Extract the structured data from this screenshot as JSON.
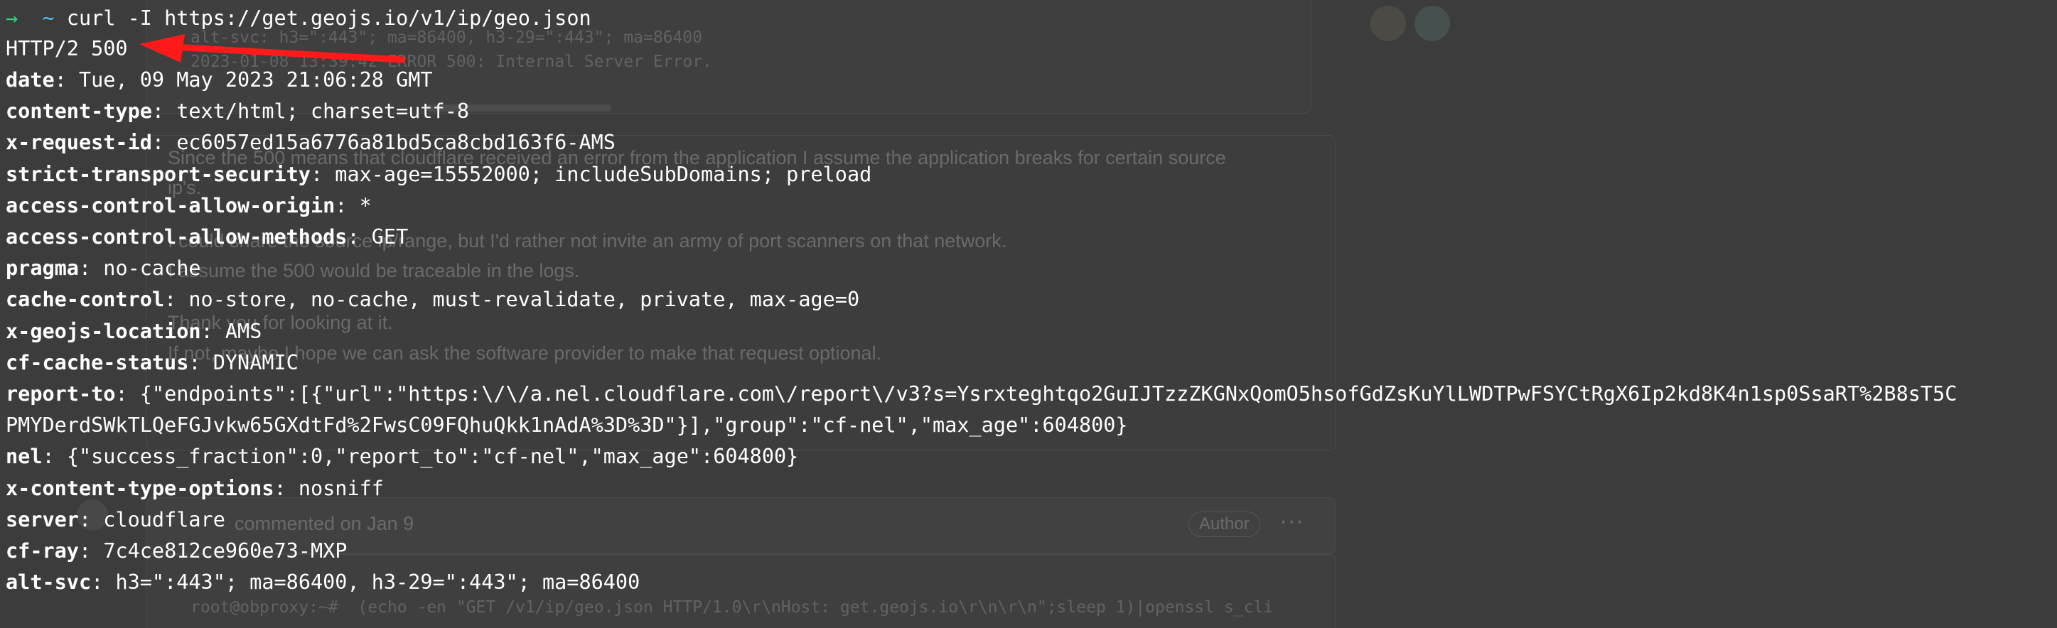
{
  "background": {
    "code_top_1": "alt-svc: h3=\":443\"; ma=86400, h3-29=\":443\"; ma=86400",
    "code_top_2": "2023-01-08 13:39:42 ERROR 500: Internal Server Error.",
    "para_1": "Since the 500 means that cloudflare received an error from the application I assume the application breaks for certain source",
    "para_1b": "ip's.",
    "para_2": "I could share the source ip/range, but I'd rather not invite an army of port scanners on that network.",
    "para_3": "I assume the 500 would be traceable in the logs.",
    "para_4": "Thank you for looking at it.",
    "para_5": "If not, maybe I hope we can ask the software provider to make that request optional.",
    "comment_header": "commented on Jan 9",
    "author_badge": "Author",
    "more_dots": "···",
    "code_bottom": "root@obproxy:~#  (echo -en \"GET /v1/ip/geo.json HTTP/1.0\\r\\nHost: get.geojs.io\\r\\n\\r\\n\";sleep 1)|openssl s_cli"
  },
  "terminal": {
    "prompt_arrow": "→",
    "prompt_dir": "~",
    "command": "curl -I https://get.geojs.io/v1/ip/geo.json",
    "status_line": "HTTP/2 500",
    "headers": [
      {
        "key": "date",
        "value": "Tue, 09 May 2023 21:06:28 GMT"
      },
      {
        "key": "content-type",
        "value": "text/html; charset=utf-8"
      },
      {
        "key": "x-request-id",
        "value": "ec6057ed15a6776a81bd5ca8cbd163f6-AMS"
      },
      {
        "key": "strict-transport-security",
        "value": "max-age=15552000; includeSubDomains; preload"
      },
      {
        "key": "access-control-allow-origin",
        "value": "*"
      },
      {
        "key": "access-control-allow-methods",
        "value": "GET"
      },
      {
        "key": "pragma",
        "value": "no-cache"
      },
      {
        "key": "cache-control",
        "value": "no-store, no-cache, must-revalidate, private, max-age=0"
      },
      {
        "key": "x-geojs-location",
        "value": "AMS"
      },
      {
        "key": "cf-cache-status",
        "value": "DYNAMIC"
      },
      {
        "key": "report-to",
        "value": "{\"endpoints\":[{\"url\":\"https:\\/\\/a.nel.cloudflare.com\\/report\\/v3?s=Ysrxteghtqo2GuIJTzzZKGNxQomO5hsofGdZsKuYlLWDTPwFSYCtRgX6Ip2kd8K4n1sp0SsaRT%2B8sT5C"
      },
      {
        "key": "",
        "value": "PMYDerdSWkTLQeFGJvkw65GXdtFd%2FwsC09FQhuQkk1nAdA%3D%3D\"}],\"group\":\"cf-nel\",\"max_age\":604800}"
      },
      {
        "key": "nel",
        "value": "{\"success_fraction\":0,\"report_to\":\"cf-nel\",\"max_age\":604800}"
      },
      {
        "key": "x-content-type-options",
        "value": "nosniff"
      },
      {
        "key": "server",
        "value": "cloudflare"
      },
      {
        "key": "cf-ray",
        "value": "7c4ce812ce960e73-MXP"
      },
      {
        "key": "alt-svc",
        "value": "h3=\":443\"; ma=86400, h3-29=\":443\"; ma=86400"
      }
    ]
  },
  "colors": {
    "terminal_bg": "#3c3c3c",
    "text": "#ffffff",
    "prompt_arrow": "#33d17a",
    "prompt_dir": "#4fc3f7",
    "annotation_arrow": "#ff1a1a"
  }
}
